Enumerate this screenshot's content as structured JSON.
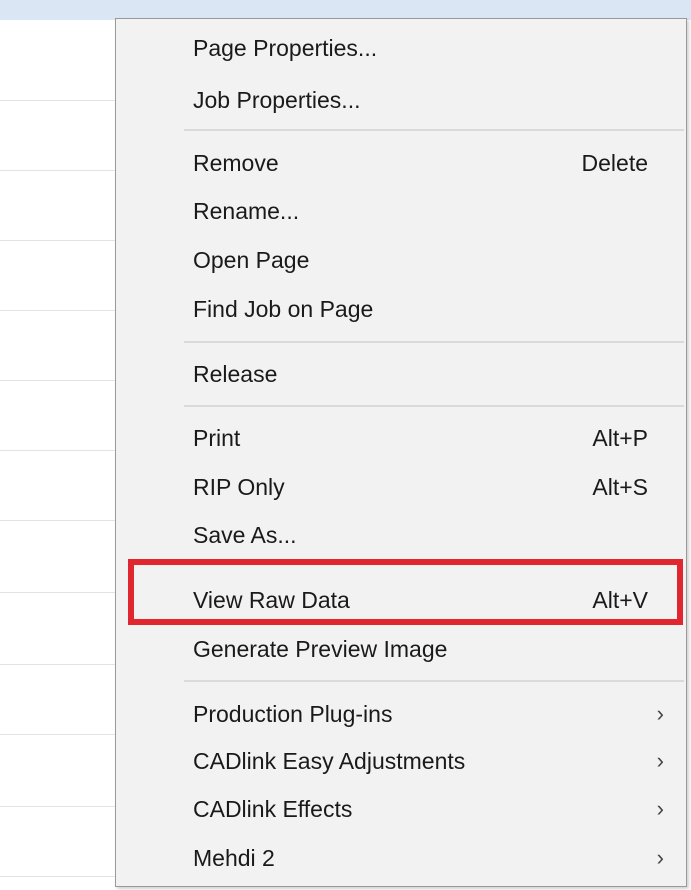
{
  "context_menu": {
    "groups": [
      [
        {
          "label": "Page Properties...",
          "shortcut": ""
        },
        {
          "label": "Job Properties...",
          "shortcut": ""
        }
      ],
      [
        {
          "label": "Remove",
          "shortcut": "Delete"
        },
        {
          "label": "Rename...",
          "shortcut": ""
        },
        {
          "label": "Open Page",
          "shortcut": ""
        },
        {
          "label": "Find Job on Page",
          "shortcut": ""
        }
      ],
      [
        {
          "label": "Release",
          "shortcut": ""
        }
      ],
      [
        {
          "label": "Print",
          "shortcut": "Alt+P"
        },
        {
          "label": "RIP Only",
          "shortcut": "Alt+S"
        },
        {
          "label": "Save As...",
          "shortcut": ""
        },
        {
          "label": "View Raw Data",
          "shortcut": "Alt+V",
          "highlighted": true
        },
        {
          "label": "Generate Preview Image",
          "shortcut": ""
        }
      ],
      [
        {
          "label": "Production Plug-ins",
          "submenu": true
        },
        {
          "label": "CADlink Easy Adjustments",
          "submenu": true
        },
        {
          "label": "CADlink Effects",
          "submenu": true
        },
        {
          "label": "Mehdi 2",
          "submenu": true
        }
      ]
    ],
    "submenu_glyph": "›",
    "highlight_color": "#e0262e"
  }
}
